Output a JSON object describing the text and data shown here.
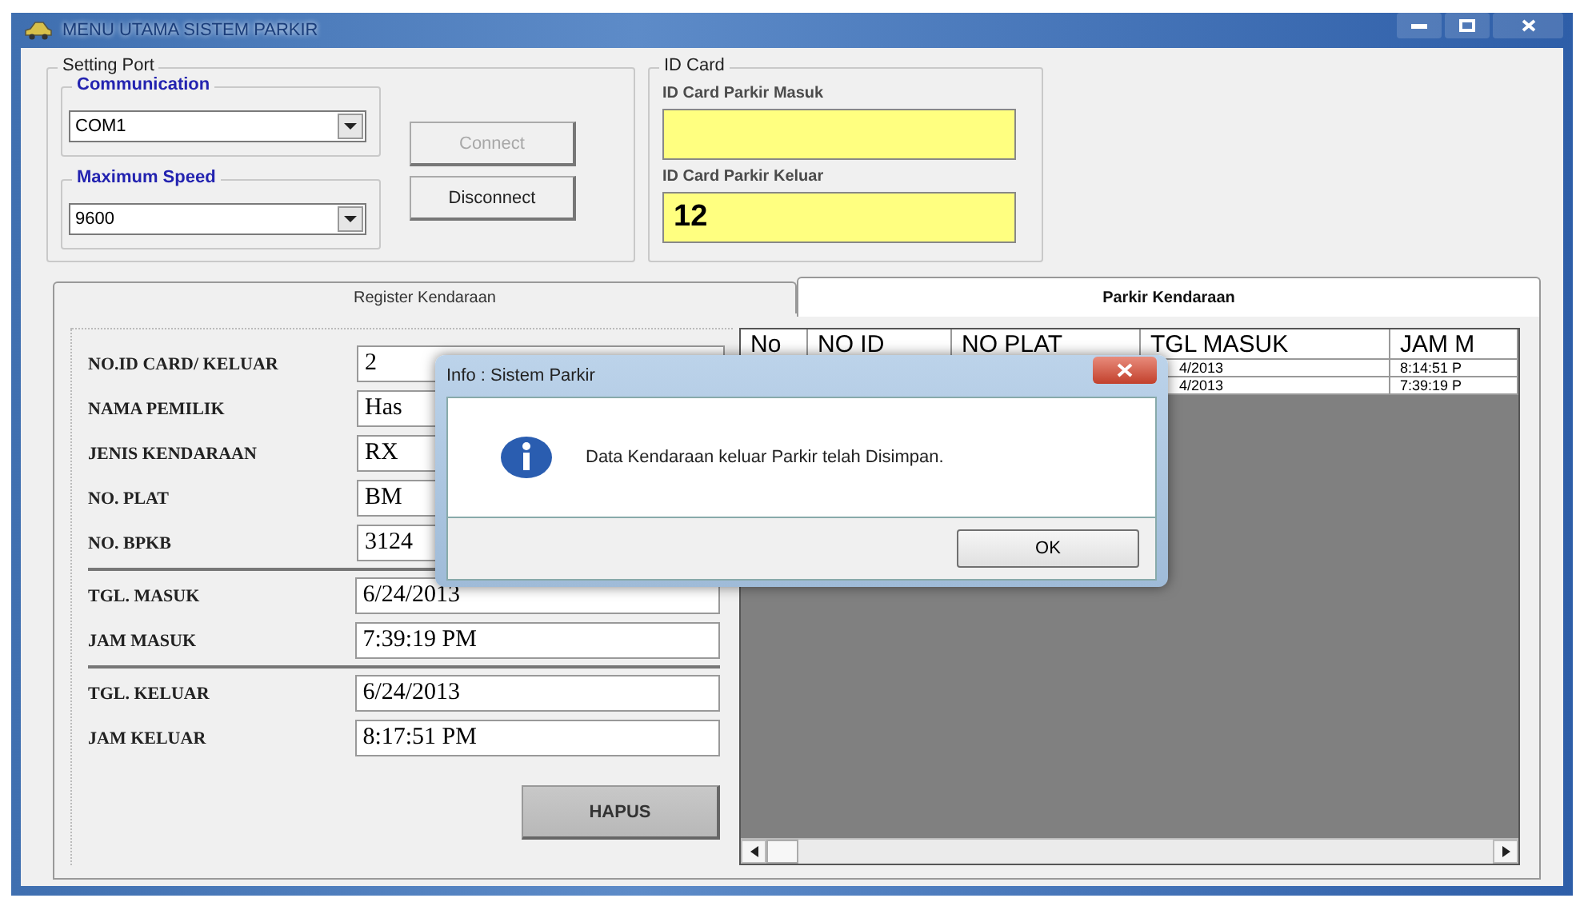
{
  "window": {
    "title": "MENU UTAMA SISTEM PARKIR"
  },
  "setting_port": {
    "title": "Setting Port",
    "communication": {
      "label": "Communication",
      "value": "COM1"
    },
    "maximum_speed": {
      "label": "Maximum Speed",
      "value": "9600"
    },
    "buttons": [
      {
        "label": "Connect",
        "disabled": true
      },
      {
        "label": "Disconnect",
        "disabled": false
      }
    ]
  },
  "id_card": {
    "title": "ID Card",
    "fields": [
      {
        "label": "ID Card Parkir Masuk"
      },
      {
        "label": "ID Card Parkir Keluar",
        "value": "12"
      }
    ]
  },
  "tabs": [
    {
      "label": "Register Kendaraan",
      "selected": false
    },
    {
      "label": "Parkir Kendaraan",
      "selected": true
    }
  ],
  "form": {
    "groups": [
      [
        {
          "label": "NO.ID CARD/ KELUAR",
          "value": "2"
        },
        {
          "label": "NAMA PEMILIK",
          "value": "Has"
        },
        {
          "label": "JENIS KENDARAAN",
          "value": "RX"
        },
        {
          "label": "NO.  PLAT",
          "value": "BM"
        },
        {
          "label": "NO.  BPKB",
          "value": "3124"
        }
      ],
      [
        {
          "label": "TGL. MASUK",
          "value": "6/24/2013"
        },
        {
          "label": "JAM MASUK",
          "value": "7:39:19 PM"
        }
      ],
      [
        {
          "label": "TGL. KELUAR",
          "value": "6/24/2013"
        },
        {
          "label": "JAM KELUAR",
          "value": "8:17:51 PM"
        }
      ]
    ],
    "button": "HAPUS"
  },
  "grid": {
    "columns": [
      "No",
      "NO ID",
      "NO PLAT",
      "TGL MASUK",
      "JAM M"
    ],
    "rows": [
      {
        "tgl_masuk": "4/2013",
        "jam_masuk": "8:14:51 P"
      },
      {
        "tgl_masuk": "4/2013",
        "jam_masuk": "7:39:19 P"
      }
    ]
  },
  "dialog": {
    "title": "Info : Sistem Parkir",
    "message": "Data Kendaraan keluar Parkir telah Disimpan.",
    "button": "OK"
  }
}
